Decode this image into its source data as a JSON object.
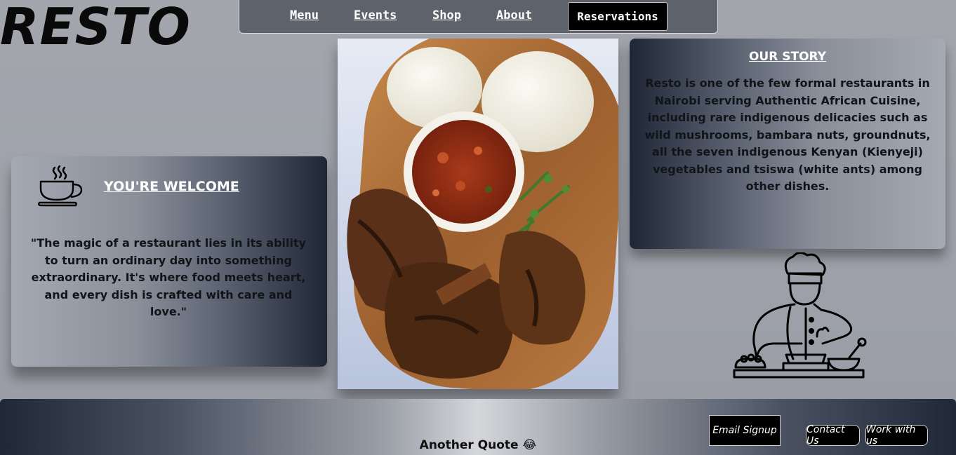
{
  "logo": "RESTO",
  "nav": {
    "menu": "Menu",
    "events": "Events",
    "shop": "Shop",
    "about": "About",
    "reservations": "Reservations"
  },
  "welcome": {
    "title": "YOU'RE WELCOME",
    "quote": "\"The magic of a restaurant lies in its ability to turn an ordinary day into something extraordinary. It's where food meets heart, and every dish is crafted with care and love.\"",
    "icon": "coffee-cup-icon"
  },
  "story": {
    "title": "OUR STORY",
    "text": "Resto is one of the few formal restaurants in Nairobi serving Authentic African Cuisine, including rare indigenous delicacies such as wild mushrooms, bambara nuts, groundnuts, all the seven indigenous Kenyan (Kienyeji) vegetables and tsiswa (white ants) among other dishes.",
    "icon": "chef-cooking-icon"
  },
  "footer": {
    "quote": "Another Quote 😂",
    "email_signup": "Email Signup",
    "contact_us": "Contact Us",
    "work_with_us": "Work with us"
  },
  "colors": {
    "page_bg": "#9fa2aa",
    "navbar_bg": "#5e626a",
    "card_dark": "#1f2636",
    "button_bg": "#000000",
    "text_dark": "#111418"
  }
}
